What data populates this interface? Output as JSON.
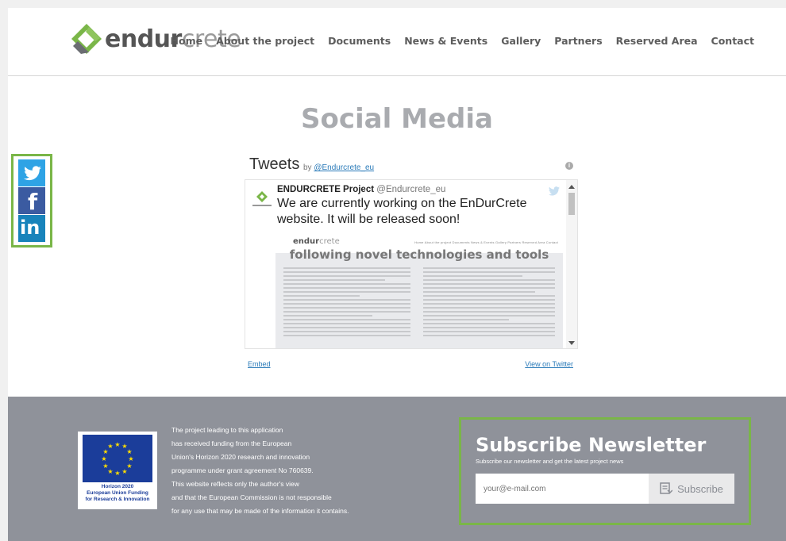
{
  "brand": {
    "logo_dark": "endur",
    "logo_light": "crete"
  },
  "nav": [
    {
      "label": "Home"
    },
    {
      "label": "About the project"
    },
    {
      "label": "Documents"
    },
    {
      "label": "News & Events"
    },
    {
      "label": "Gallery"
    },
    {
      "label": "Partners"
    },
    {
      "label": "Reserved Area"
    },
    {
      "label": "Contact"
    }
  ],
  "page_title": "Social Media",
  "twitter": {
    "title": "Tweets",
    "by_prefix": "by",
    "by_handle": "@Endurcrete_eu",
    "tweet": {
      "name": "ENDURCRETE Project",
      "handle": "@Endurcrete_eu",
      "text": "We are currently working on the EnDurCrete website. It will be released soon!",
      "preview_heading": "following novel technologies and tools",
      "preview_logo_dark": "endur",
      "preview_logo_light": "crete",
      "preview_nav": "Home   About the project   Documents   News & Events   Gallery   Partners   Reserved Area   Contact"
    },
    "embed_label": "Embed",
    "view_label": "View on Twitter"
  },
  "social": {
    "icons": [
      "twitter-icon",
      "facebook-icon",
      "linkedin-icon"
    ],
    "facebook_glyph": "f",
    "linkedin_glyph": "in"
  },
  "footer": {
    "eu_line1": "Horizon 2020",
    "eu_line2": "European Union Funding",
    "eu_line3": "for Research & Innovation",
    "funding_lines": [
      "The project leading to this application",
      "has received funding from the European",
      "Union's Horizon 2020 research and innovation",
      "programme under grant agreement No 760639.",
      "This website reflects only the author's view",
      "and that the European Commission is not responsible",
      "for any use that may be made of the information it contains."
    ],
    "newsletter": {
      "title": "Subscribe Newsletter",
      "desc": "Subscribe our newsletter and get the latest project news",
      "placeholder": "your@e-mail.com",
      "button_label": "Subscribe"
    }
  },
  "colors": {
    "accent_green": "#7ab648",
    "footer_gray": "#8f929a",
    "twitter_blue": "#2ea3e5",
    "facebook_blue": "#3b5ba1",
    "linkedin_blue": "#1883bb"
  }
}
